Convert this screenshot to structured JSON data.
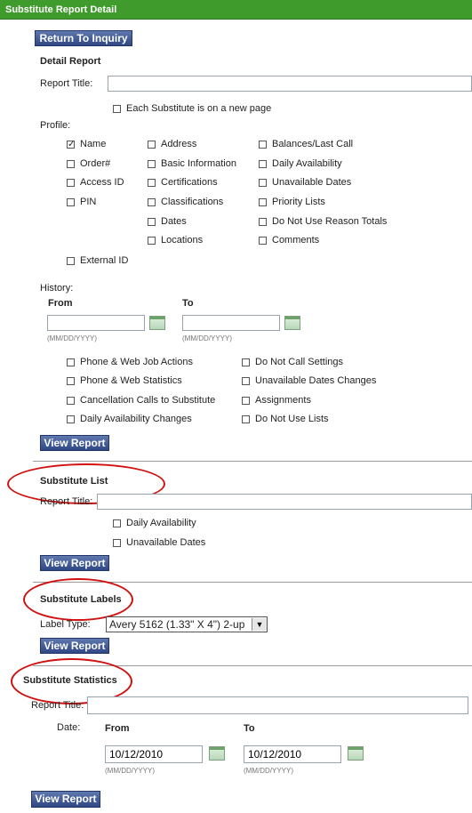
{
  "header": {
    "title": "Substitute Report Detail"
  },
  "return_button": "Return To Inquiry",
  "detail": {
    "heading": "Detail Report",
    "report_title_label": "Report Title:",
    "new_page_label": "Each Substitute is on a new page",
    "profile_label": "Profile:",
    "profile_col1": [
      "Name",
      "Order#",
      "Access ID",
      "PIN"
    ],
    "profile_col2": [
      "Address",
      "Basic Information",
      "Certifications",
      "Classifications",
      "Dates",
      "Locations"
    ],
    "profile_col3": [
      "Balances/Last Call",
      "Daily Availability",
      "Unavailable Dates",
      "Priority Lists",
      "Do Not Use Reason Totals",
      "Comments"
    ],
    "external_id": "External ID",
    "history_label": "History:",
    "from_label": "From",
    "to_label": "To",
    "date_format": "(MM/DD/YYYY)",
    "history_left": [
      "Phone & Web Job Actions",
      "Phone & Web Statistics",
      "Cancellation Calls to Substitute",
      "Daily Availability Changes"
    ],
    "history_right": [
      "Do Not Call Settings",
      "Unavailable Dates Changes",
      "Assignments",
      "Do Not Use Lists"
    ],
    "view_report": "View Report"
  },
  "sub_list": {
    "heading": "Substitute List",
    "report_title_label": "Report Title:",
    "options": [
      "Daily Availability",
      "Unavailable Dates"
    ],
    "view_report": "View Report"
  },
  "sub_labels": {
    "heading": "Substitute Labels",
    "label_type_label": "Label Type:",
    "label_type_value": "Avery 5162 (1.33\" X 4\") 2-up",
    "view_report": "View Report"
  },
  "sub_stats": {
    "heading": "Substitute Statistics",
    "report_title_label": "Report Title:",
    "date_label": "Date:",
    "from_label": "From",
    "to_label": "To",
    "from_value": "10/12/2010",
    "to_value": "10/12/2010",
    "date_format": "(MM/DD/YYYY)",
    "view_report": "View Report"
  },
  "colors": {
    "header_green": "#3f9b2b",
    "button_blue": "#2f4784",
    "annotation_red": "#d11010"
  }
}
